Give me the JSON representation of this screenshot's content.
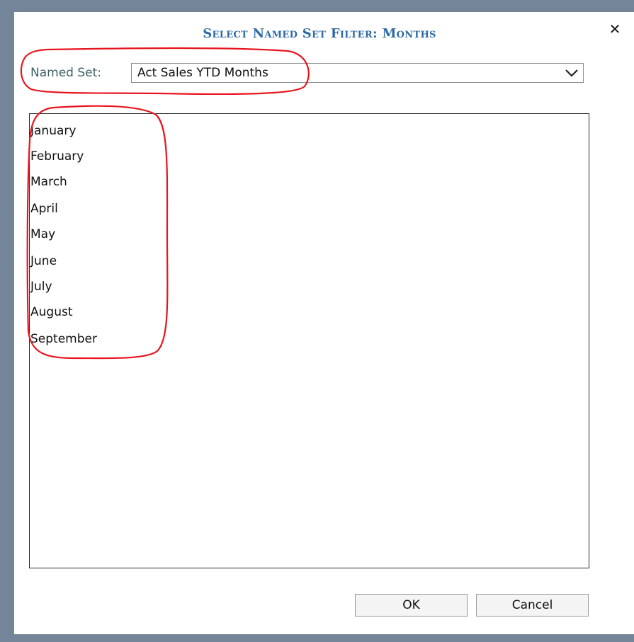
{
  "dialog": {
    "title": "Select Named Set Filter: Months",
    "close_glyph": "✕"
  },
  "named_set": {
    "label": "Named Set:",
    "selected_value": "Act Sales YTD Months",
    "dropdown_icon": "chevron-down-icon"
  },
  "members": [
    "January",
    "February",
    "March",
    "April",
    "May",
    "June",
    "July",
    "August",
    "September"
  ],
  "buttons": {
    "ok_label": "OK",
    "cancel_label": "Cancel"
  },
  "colors": {
    "backdrop": "#74859a",
    "title": "#2e6aa6",
    "label": "#3f5f68",
    "annotation": "#e8141e"
  }
}
